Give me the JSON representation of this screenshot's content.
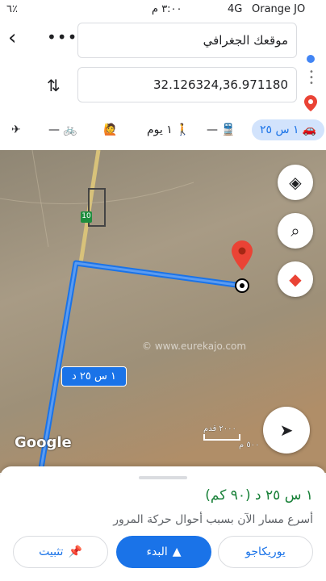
{
  "status_bar": {
    "battery": "٦٪",
    "time": "٣:٠٠ م",
    "network": "4G",
    "carrier": "Orange JO"
  },
  "directions": {
    "origin_text": "موقعك الجغرافي",
    "destination_text": "32.126324,36.971180"
  },
  "modes": {
    "flight": "—",
    "bike": "—",
    "walk": "١ يوم",
    "transit": "—",
    "drive": "١ س ٢٥"
  },
  "map": {
    "route_label": "١ س ٢٥ د",
    "road_number": "10",
    "watermark": "© www.eurekajo.com",
    "google_logo": "Google",
    "scale_text": "٢٠٠٠ قدم",
    "scale_unit": "٥٠٠ م",
    "route_color": "#1a73e8"
  },
  "sheet": {
    "summary": "١ س ٢٥ د (٩٠ كم)",
    "note": "أسرع مسار الآن بسبب أحوال حركة المرور",
    "pin_label": "تثبيت",
    "start_label": "البدء",
    "share_label": "يوريكاجو"
  }
}
